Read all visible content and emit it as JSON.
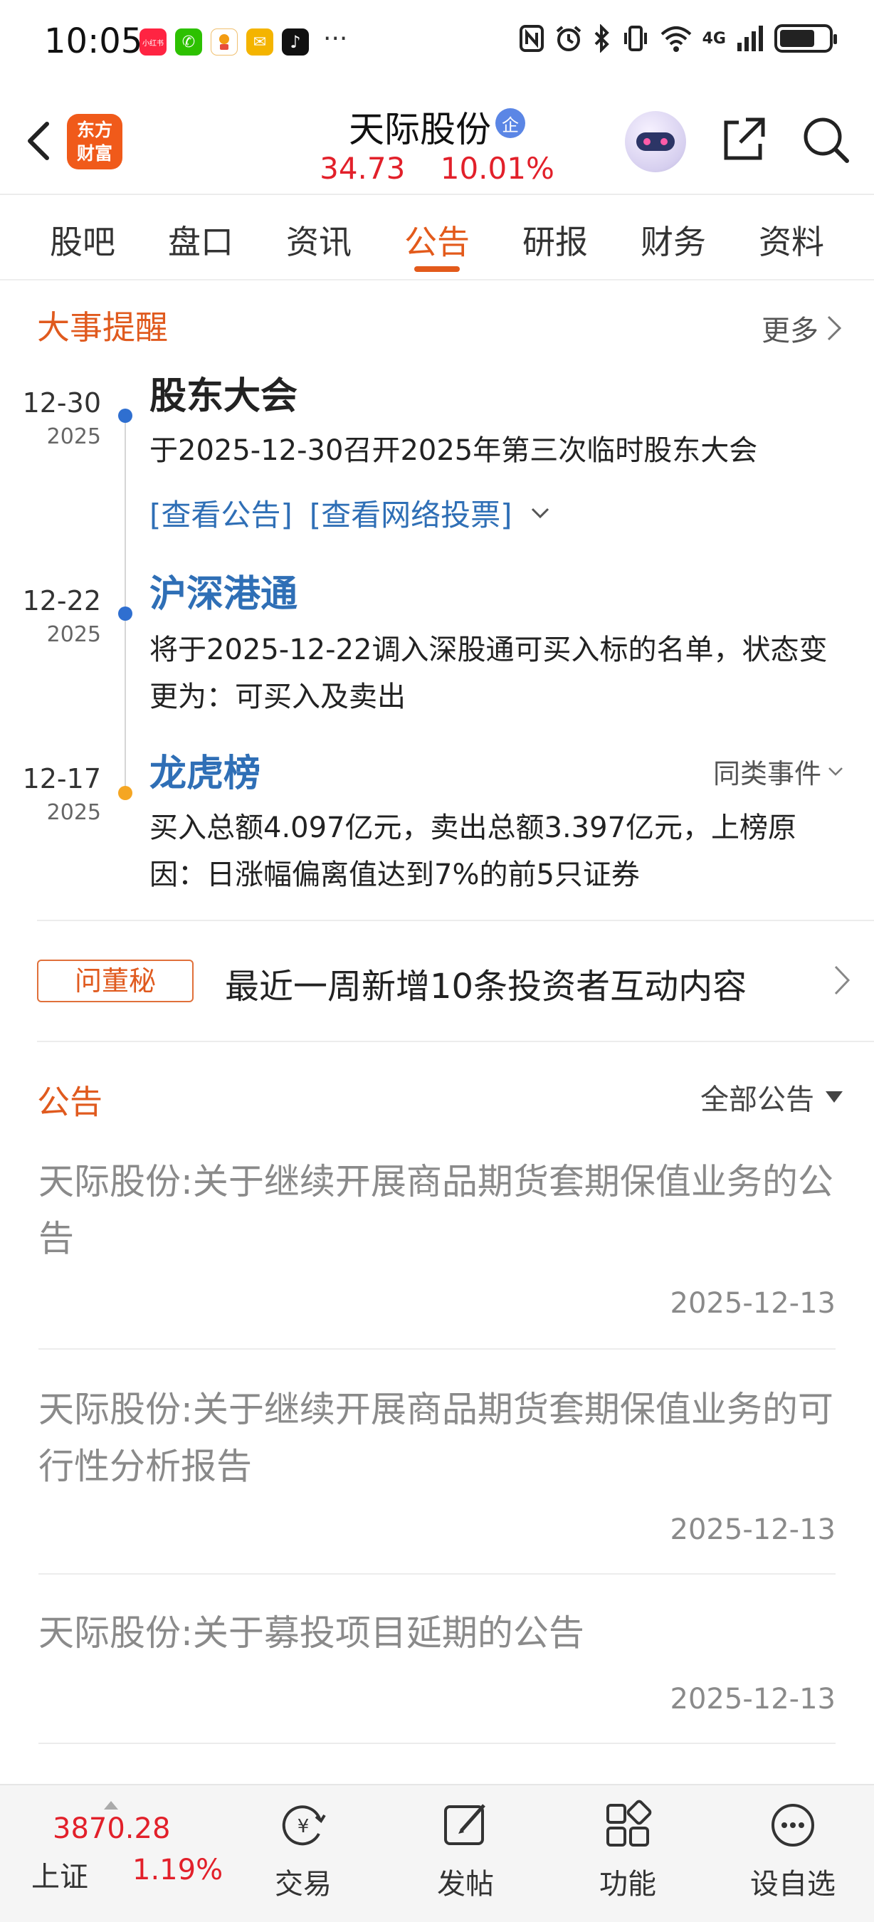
{
  "status_bar": {
    "time": "10:05",
    "notif_apps": [
      {
        "name": "xiaohongshu",
        "color": "#ff2442",
        "label": "小红书"
      },
      {
        "name": "wechat",
        "color": "#2dc100",
        "label": "✆"
      },
      {
        "name": "lottery",
        "color": "#ffffff",
        "label": ""
      },
      {
        "name": "mail",
        "color": "#f4b400",
        "label": "✉"
      },
      {
        "name": "tiktok",
        "color": "#111111",
        "label": "♪"
      }
    ],
    "more": "···",
    "signal_text": "4G",
    "battery_level": 0.72
  },
  "header": {
    "logo_text_line1": "东方",
    "logo_text_line2": "财富",
    "stock_name": "天际股份",
    "badge": "企",
    "price": "34.73",
    "change_pct": "10.01%"
  },
  "tabs": [
    "股吧",
    "盘口",
    "资讯",
    "公告",
    "研报",
    "财务",
    "资料"
  ],
  "active_tab": "公告",
  "events": {
    "title": "大事提醒",
    "more": "更多",
    "items": [
      {
        "date": "12-30",
        "year": "2025",
        "title": "股东大会",
        "body": "于2025-12-30召开2025年第三次临时股东大会",
        "links": [
          "[查看公告]",
          "[查看网络投票]"
        ]
      },
      {
        "date": "12-22",
        "year": "2025",
        "title": "沪深港通",
        "body": "将于2025-12-22调入深股通可买入标的名单，状态变更为：可买入及卖出"
      },
      {
        "date": "12-17",
        "year": "2025",
        "title": "龙虎榜",
        "side_link": "同类事件",
        "body": "买入总额4.097亿元，卖出总额3.397亿元，上榜原因：日涨幅偏离值达到7%的前5只证券"
      }
    ]
  },
  "ask_secretary": {
    "badge": "问董秘",
    "text": "最近一周新增10条投资者互动内容"
  },
  "announcements": {
    "title": "公告",
    "filter": "全部公告",
    "items": [
      {
        "title": "天际股份:关于继续开展商品期货套期保值业务的公告",
        "date": "2025-12-13"
      },
      {
        "title": "天际股份:关于继续开展商品期货套期保值业务的可行性分析报告",
        "date": "2025-12-13"
      },
      {
        "title": "天际股份:关于募投项目延期的公告",
        "date": "2025-12-13"
      }
    ]
  },
  "bottom_nav": {
    "index_value": "3870.28",
    "index_name": "上证",
    "index_change": "1.19%",
    "items": [
      "交易",
      "发帖",
      "功能",
      "设自选"
    ]
  }
}
